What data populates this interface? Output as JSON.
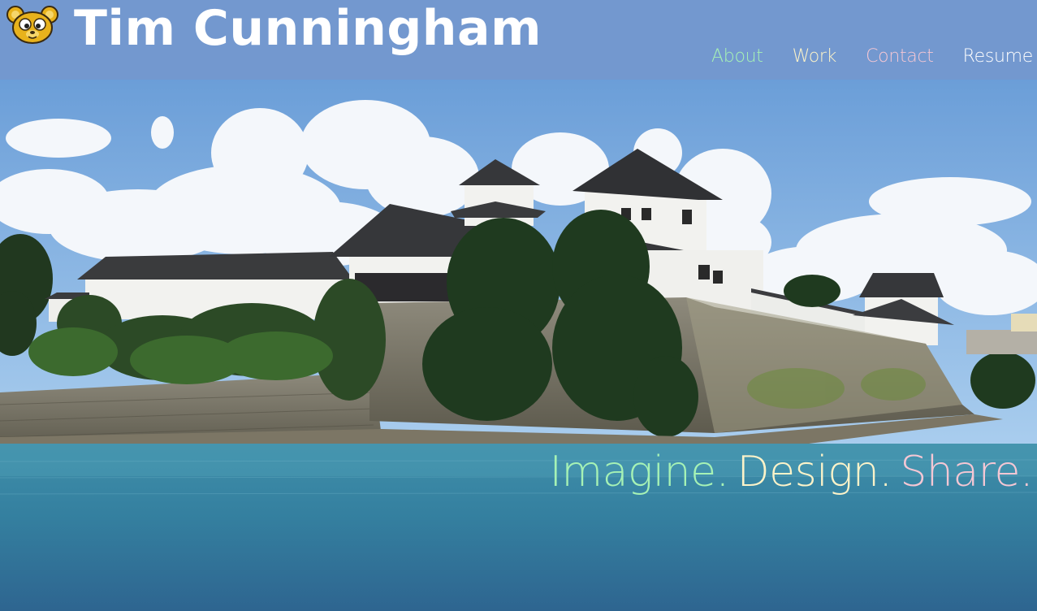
{
  "site": {
    "title": "Tim Cunningham",
    "logo_icon": "bear-face-icon"
  },
  "nav": {
    "items": [
      {
        "label": "About",
        "color": "#a6f2b5"
      },
      {
        "label": "Work",
        "color": "#fcf3c9"
      },
      {
        "label": "Contact",
        "color": "#f5c7d4"
      },
      {
        "label": "Resume",
        "color": "#ffffff"
      }
    ]
  },
  "hero": {
    "image_icon": "castle-photo",
    "tagline": [
      {
        "text": "Imagine.",
        "color": "#a6f2b5"
      },
      {
        "text": "Design.",
        "color": "#fcf3c9"
      },
      {
        "text": "Share.",
        "color": "#f5c7d4"
      }
    ]
  },
  "colors": {
    "header_bg": "#7398cf",
    "title": "#ffffff"
  }
}
